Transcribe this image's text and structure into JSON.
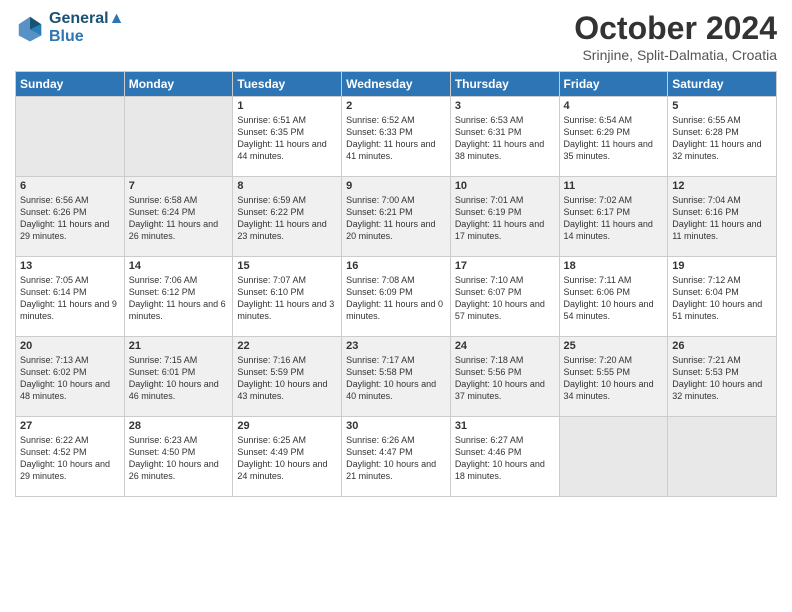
{
  "header": {
    "logo_line1": "General",
    "logo_line2": "Blue",
    "month_title": "October 2024",
    "location": "Srinjine, Split-Dalmatia, Croatia"
  },
  "days_of_week": [
    "Sunday",
    "Monday",
    "Tuesday",
    "Wednesday",
    "Thursday",
    "Friday",
    "Saturday"
  ],
  "weeks": [
    [
      {
        "day": "",
        "sunrise": "",
        "sunset": "",
        "daylight": ""
      },
      {
        "day": "",
        "sunrise": "",
        "sunset": "",
        "daylight": ""
      },
      {
        "day": "1",
        "sunrise": "Sunrise: 6:51 AM",
        "sunset": "Sunset: 6:35 PM",
        "daylight": "Daylight: 11 hours and 44 minutes."
      },
      {
        "day": "2",
        "sunrise": "Sunrise: 6:52 AM",
        "sunset": "Sunset: 6:33 PM",
        "daylight": "Daylight: 11 hours and 41 minutes."
      },
      {
        "day": "3",
        "sunrise": "Sunrise: 6:53 AM",
        "sunset": "Sunset: 6:31 PM",
        "daylight": "Daylight: 11 hours and 38 minutes."
      },
      {
        "day": "4",
        "sunrise": "Sunrise: 6:54 AM",
        "sunset": "Sunset: 6:29 PM",
        "daylight": "Daylight: 11 hours and 35 minutes."
      },
      {
        "day": "5",
        "sunrise": "Sunrise: 6:55 AM",
        "sunset": "Sunset: 6:28 PM",
        "daylight": "Daylight: 11 hours and 32 minutes."
      }
    ],
    [
      {
        "day": "6",
        "sunrise": "Sunrise: 6:56 AM",
        "sunset": "Sunset: 6:26 PM",
        "daylight": "Daylight: 11 hours and 29 minutes."
      },
      {
        "day": "7",
        "sunrise": "Sunrise: 6:58 AM",
        "sunset": "Sunset: 6:24 PM",
        "daylight": "Daylight: 11 hours and 26 minutes."
      },
      {
        "day": "8",
        "sunrise": "Sunrise: 6:59 AM",
        "sunset": "Sunset: 6:22 PM",
        "daylight": "Daylight: 11 hours and 23 minutes."
      },
      {
        "day": "9",
        "sunrise": "Sunrise: 7:00 AM",
        "sunset": "Sunset: 6:21 PM",
        "daylight": "Daylight: 11 hours and 20 minutes."
      },
      {
        "day": "10",
        "sunrise": "Sunrise: 7:01 AM",
        "sunset": "Sunset: 6:19 PM",
        "daylight": "Daylight: 11 hours and 17 minutes."
      },
      {
        "day": "11",
        "sunrise": "Sunrise: 7:02 AM",
        "sunset": "Sunset: 6:17 PM",
        "daylight": "Daylight: 11 hours and 14 minutes."
      },
      {
        "day": "12",
        "sunrise": "Sunrise: 7:04 AM",
        "sunset": "Sunset: 6:16 PM",
        "daylight": "Daylight: 11 hours and 11 minutes."
      }
    ],
    [
      {
        "day": "13",
        "sunrise": "Sunrise: 7:05 AM",
        "sunset": "Sunset: 6:14 PM",
        "daylight": "Daylight: 11 hours and 9 minutes."
      },
      {
        "day": "14",
        "sunrise": "Sunrise: 7:06 AM",
        "sunset": "Sunset: 6:12 PM",
        "daylight": "Daylight: 11 hours and 6 minutes."
      },
      {
        "day": "15",
        "sunrise": "Sunrise: 7:07 AM",
        "sunset": "Sunset: 6:10 PM",
        "daylight": "Daylight: 11 hours and 3 minutes."
      },
      {
        "day": "16",
        "sunrise": "Sunrise: 7:08 AM",
        "sunset": "Sunset: 6:09 PM",
        "daylight": "Daylight: 11 hours and 0 minutes."
      },
      {
        "day": "17",
        "sunrise": "Sunrise: 7:10 AM",
        "sunset": "Sunset: 6:07 PM",
        "daylight": "Daylight: 10 hours and 57 minutes."
      },
      {
        "day": "18",
        "sunrise": "Sunrise: 7:11 AM",
        "sunset": "Sunset: 6:06 PM",
        "daylight": "Daylight: 10 hours and 54 minutes."
      },
      {
        "day": "19",
        "sunrise": "Sunrise: 7:12 AM",
        "sunset": "Sunset: 6:04 PM",
        "daylight": "Daylight: 10 hours and 51 minutes."
      }
    ],
    [
      {
        "day": "20",
        "sunrise": "Sunrise: 7:13 AM",
        "sunset": "Sunset: 6:02 PM",
        "daylight": "Daylight: 10 hours and 48 minutes."
      },
      {
        "day": "21",
        "sunrise": "Sunrise: 7:15 AM",
        "sunset": "Sunset: 6:01 PM",
        "daylight": "Daylight: 10 hours and 46 minutes."
      },
      {
        "day": "22",
        "sunrise": "Sunrise: 7:16 AM",
        "sunset": "Sunset: 5:59 PM",
        "daylight": "Daylight: 10 hours and 43 minutes."
      },
      {
        "day": "23",
        "sunrise": "Sunrise: 7:17 AM",
        "sunset": "Sunset: 5:58 PM",
        "daylight": "Daylight: 10 hours and 40 minutes."
      },
      {
        "day": "24",
        "sunrise": "Sunrise: 7:18 AM",
        "sunset": "Sunset: 5:56 PM",
        "daylight": "Daylight: 10 hours and 37 minutes."
      },
      {
        "day": "25",
        "sunrise": "Sunrise: 7:20 AM",
        "sunset": "Sunset: 5:55 PM",
        "daylight": "Daylight: 10 hours and 34 minutes."
      },
      {
        "day": "26",
        "sunrise": "Sunrise: 7:21 AM",
        "sunset": "Sunset: 5:53 PM",
        "daylight": "Daylight: 10 hours and 32 minutes."
      }
    ],
    [
      {
        "day": "27",
        "sunrise": "Sunrise: 6:22 AM",
        "sunset": "Sunset: 4:52 PM",
        "daylight": "Daylight: 10 hours and 29 minutes."
      },
      {
        "day": "28",
        "sunrise": "Sunrise: 6:23 AM",
        "sunset": "Sunset: 4:50 PM",
        "daylight": "Daylight: 10 hours and 26 minutes."
      },
      {
        "day": "29",
        "sunrise": "Sunrise: 6:25 AM",
        "sunset": "Sunset: 4:49 PM",
        "daylight": "Daylight: 10 hours and 24 minutes."
      },
      {
        "day": "30",
        "sunrise": "Sunrise: 6:26 AM",
        "sunset": "Sunset: 4:47 PM",
        "daylight": "Daylight: 10 hours and 21 minutes."
      },
      {
        "day": "31",
        "sunrise": "Sunrise: 6:27 AM",
        "sunset": "Sunset: 4:46 PM",
        "daylight": "Daylight: 10 hours and 18 minutes."
      },
      {
        "day": "",
        "sunrise": "",
        "sunset": "",
        "daylight": ""
      },
      {
        "day": "",
        "sunrise": "",
        "sunset": "",
        "daylight": ""
      }
    ]
  ]
}
